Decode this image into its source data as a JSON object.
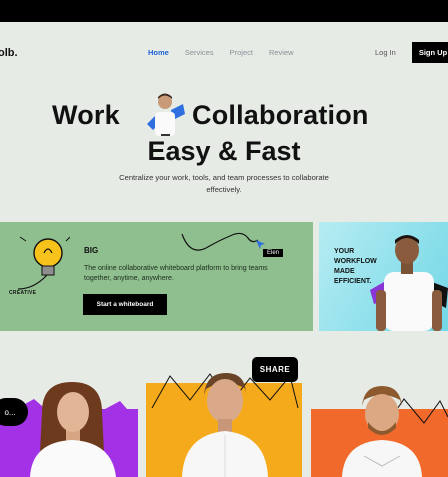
{
  "brand": {
    "logo": "olb."
  },
  "nav": {
    "items": [
      "Home",
      "Services",
      "Project",
      "Review"
    ],
    "login": "Log In",
    "signup": "Sign Up"
  },
  "hero": {
    "word1": "Work",
    "word2": "Collaboration",
    "line2": "Easy & Fast",
    "subtitle": "Centralize your work, tools, and team processes to collaborate effectively."
  },
  "card_big": {
    "title": "BIG",
    "description": "The online collaborative whiteboard platform to bring teams together, anytime, anywhere.",
    "button": "Start a whiteboard",
    "cursor_label": "Elen",
    "doodle_text": "CREATIVE"
  },
  "card_workflow": {
    "line1": "YOUR",
    "line2": "WORKFLOW",
    "line3": "MADE",
    "line4": "EFFICIENT."
  },
  "people": {
    "share_label": "SHARE",
    "bubble_left": "o..."
  },
  "colors": {
    "accent": "#1e63d6",
    "green_card": "#8fbf8e",
    "cyan_card": "#6fd6e6",
    "purple": "#a332e6",
    "orange": "#f5aa1c",
    "red_orange": "#f26a2b"
  }
}
